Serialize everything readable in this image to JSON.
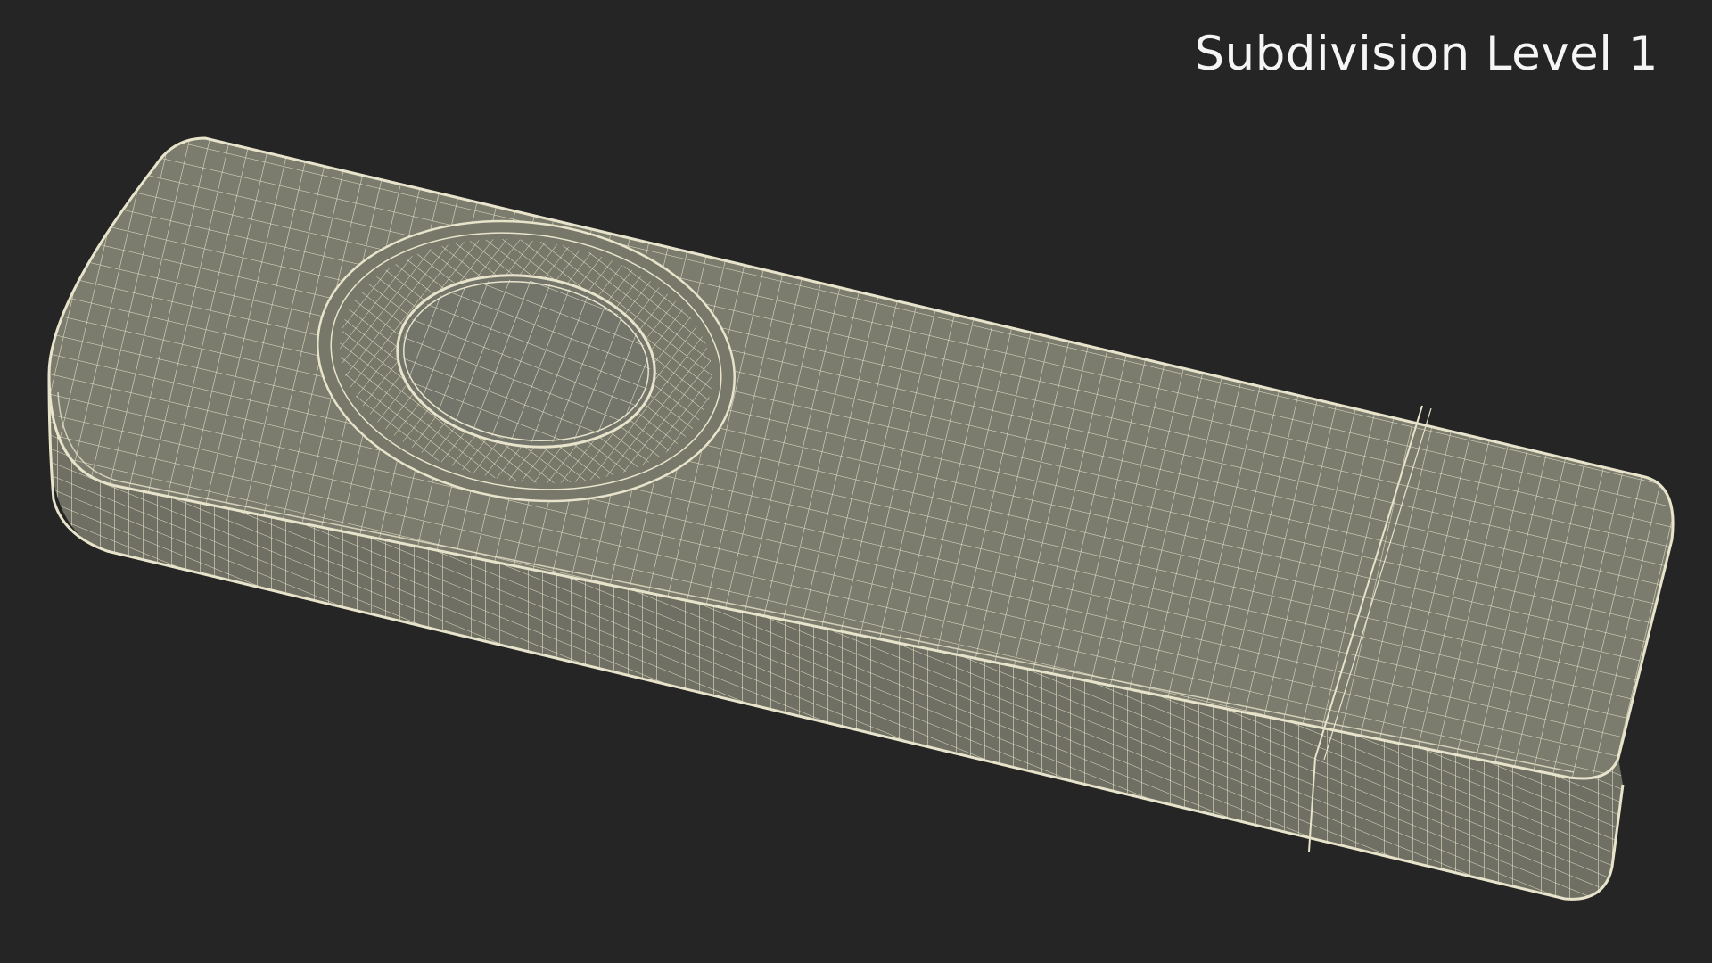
{
  "caption": "Subdivision Level 1",
  "colors": {
    "background": "#252525",
    "surface": "#7b7c6d",
    "surface_dark": "#6f7063",
    "wire": "#e8e4cc"
  }
}
